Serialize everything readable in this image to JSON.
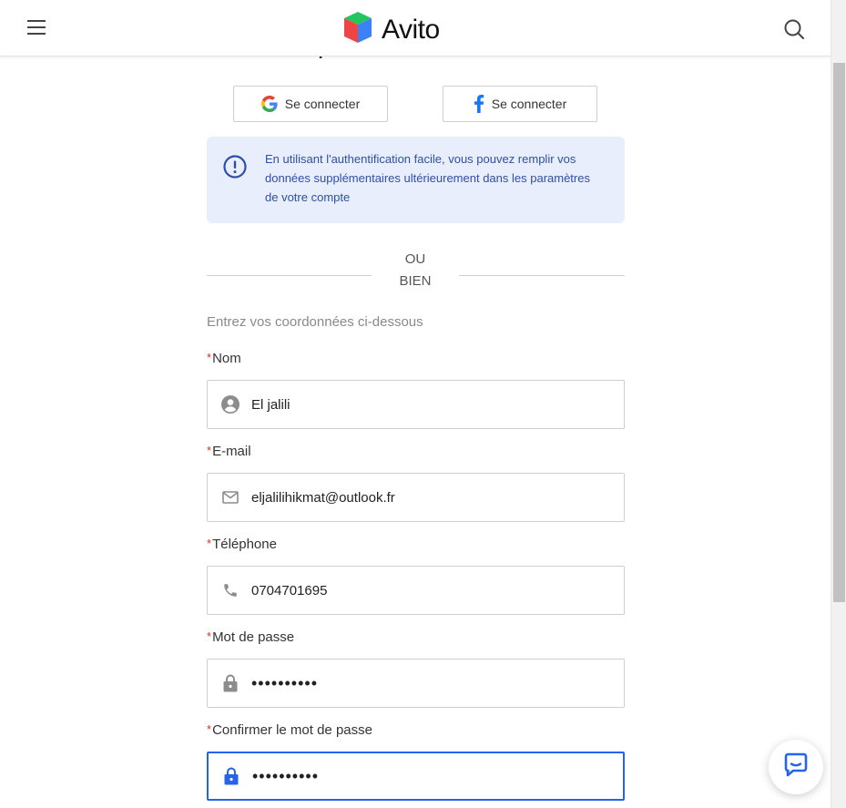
{
  "header": {
    "logo_text": "Avito"
  },
  "page": {
    "partial_title": "Créer un compte Avito.ma"
  },
  "social": {
    "google_label": "Se connecter",
    "facebook_label": "Se connecter"
  },
  "info": {
    "text": "En utilisant l'authentification facile, vous pouvez remplir vos données supplémentaires ultérieurement dans les paramètres de votre compte"
  },
  "divider": {
    "line1": "OU",
    "line2": "BIEN"
  },
  "form": {
    "hint": "Entrez vos coordonnées ci-dessous",
    "required_marker": "*",
    "nom": {
      "label": "Nom",
      "value": "El jalili"
    },
    "email": {
      "label": "E-mail",
      "value": "eljalilihikmat@outlook.fr"
    },
    "phone": {
      "label": "Téléphone",
      "value": "0704701695"
    },
    "password": {
      "label": "Mot de passe",
      "value": "••••••••••"
    },
    "confirm_password": {
      "label": "Confirmer le mot de passe",
      "value": "••••••••••"
    }
  },
  "colors": {
    "accent": "#2563eb",
    "info_bg": "#e8eefb",
    "info_text": "#2e4fa8",
    "required": "#d93025"
  },
  "icons": {
    "menu": "hamburger-icon",
    "search": "search-icon",
    "google": "google-icon",
    "facebook": "facebook-icon",
    "info": "info-icon",
    "user": "user-icon",
    "mail": "mail-icon",
    "phone": "phone-icon",
    "lock": "lock-icon",
    "chat": "chat-icon"
  }
}
